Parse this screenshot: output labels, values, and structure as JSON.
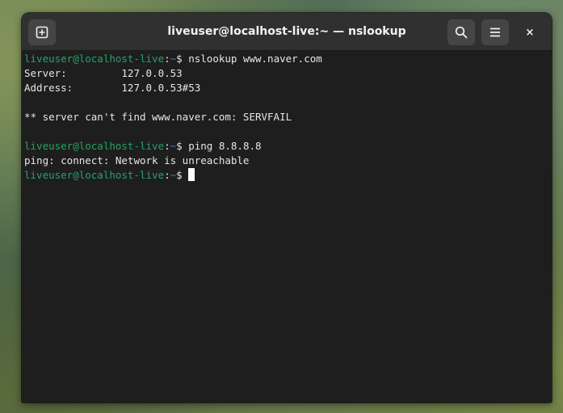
{
  "window": {
    "title": "liveuser@localhost-live:~ — nslookup"
  },
  "headerbar": {
    "new_tab_icon": "new-tab-icon",
    "search_icon": "search-icon",
    "menu_icon": "hamburger-menu-icon",
    "close_glyph": "×"
  },
  "terminal": {
    "prompt_user": "liveuser@localhost-live",
    "prompt_sep": ":",
    "prompt_path": "~",
    "prompt_end": "$ ",
    "lines": [
      {
        "type": "prompt",
        "command": "nslookup www.naver.com"
      },
      {
        "type": "output",
        "text": "Server:         127.0.0.53"
      },
      {
        "type": "output",
        "text": "Address:        127.0.0.53#53"
      },
      {
        "type": "output",
        "text": ""
      },
      {
        "type": "output",
        "text": "** server can't find www.naver.com: SERVFAIL"
      },
      {
        "type": "output",
        "text": ""
      },
      {
        "type": "prompt",
        "command": "ping 8.8.8.8"
      },
      {
        "type": "output",
        "text": "ping: connect: Network is unreachable"
      },
      {
        "type": "prompt",
        "command": "",
        "cursor": true
      }
    ]
  },
  "colors": {
    "prompt_user": "#26a269",
    "prompt_path": "#3a7bd5",
    "terminal_bg": "#1e1e1e",
    "headerbar_bg": "#303030"
  }
}
